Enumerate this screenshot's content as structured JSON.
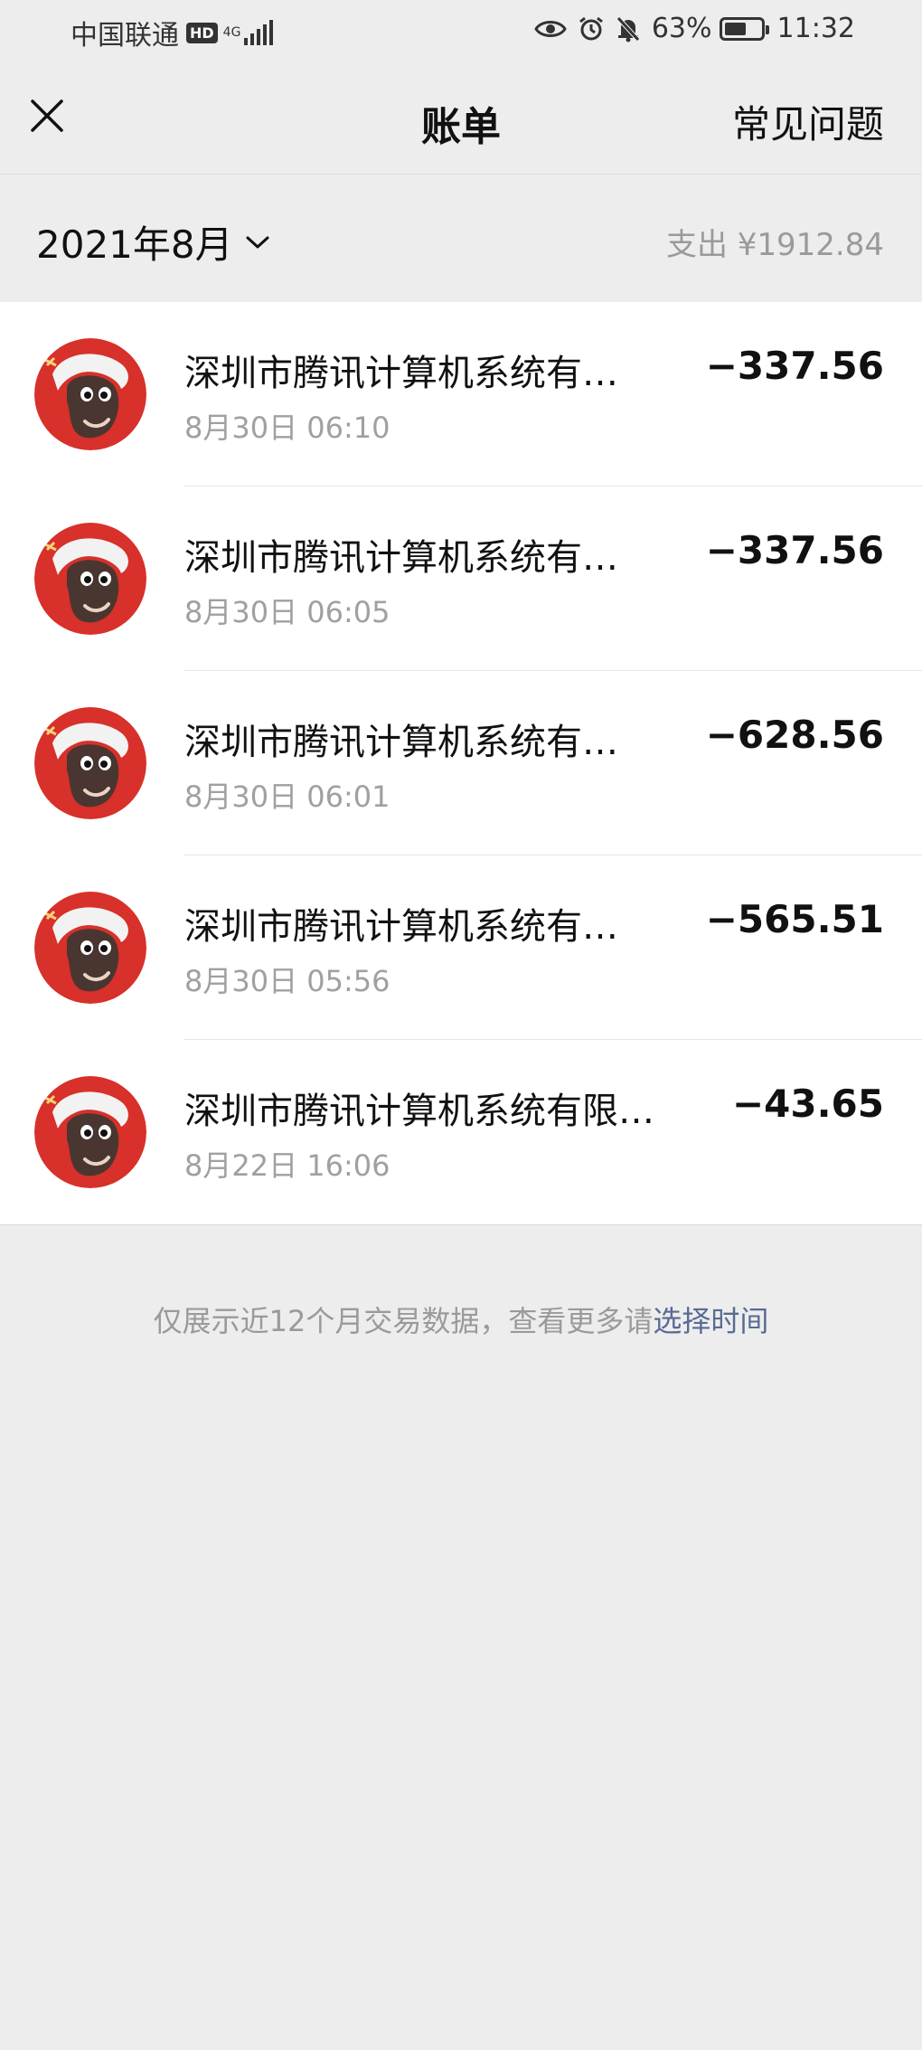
{
  "status_bar": {
    "carrier": "中国联通",
    "hd": "HD",
    "network": "4G",
    "battery_percent": "63%",
    "battery_level": 0.63,
    "time": "11:32"
  },
  "nav": {
    "title": "账单",
    "faq": "常见问题"
  },
  "month": {
    "label": "2021年8月",
    "total": "支出 ¥1912.84"
  },
  "bills": [
    {
      "name": "深圳市腾讯计算机系统有…",
      "time": "8月30日 06:10",
      "amount": "−337.56"
    },
    {
      "name": "深圳市腾讯计算机系统有…",
      "time": "8月30日 06:05",
      "amount": "−337.56"
    },
    {
      "name": "深圳市腾讯计算机系统有…",
      "time": "8月30日 06:01",
      "amount": "−628.56"
    },
    {
      "name": "深圳市腾讯计算机系统有…",
      "time": "8月30日 05:56",
      "amount": "−565.51"
    },
    {
      "name": "深圳市腾讯计算机系统有限…",
      "time": "8月22日 16:06",
      "amount": "−43.65"
    }
  ],
  "footer": {
    "text": "仅展示近12个月交易数据，查看更多请",
    "link": "选择时间"
  },
  "colors": {
    "background": "#ededed",
    "link": "#576b95",
    "muted": "#9a9a9a",
    "avatar_bg": "#d8302a"
  }
}
